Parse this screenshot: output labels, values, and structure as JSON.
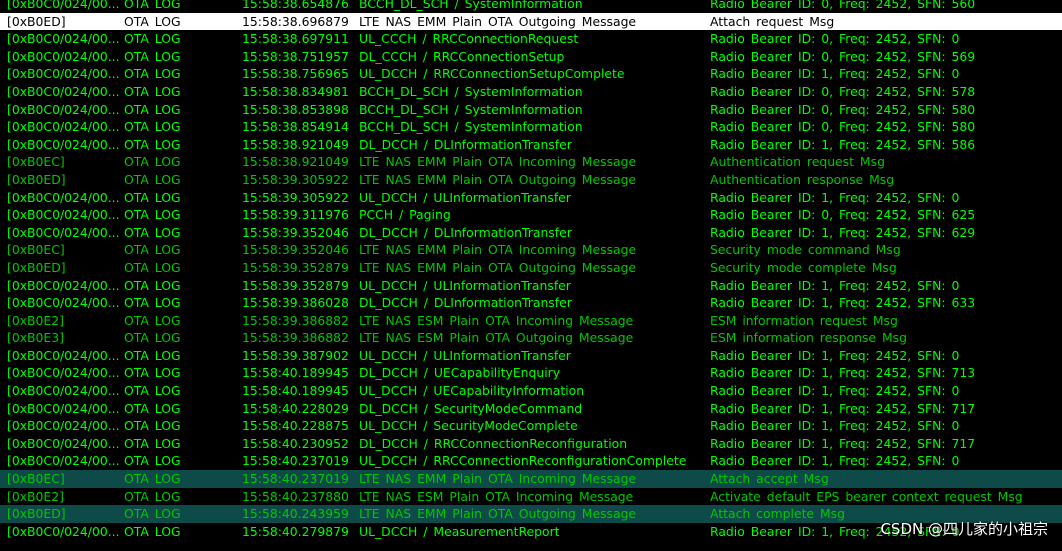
{
  "log": {
    "rows": [
      {
        "id": "[0xB0C0/024/00...",
        "type": "OTA LOG",
        "time": "15:58:38.654876",
        "name": "BCCH_DL_SCH / SystemInformation",
        "info": "Radio Bearer ID: 0, Freq: 2452, SFN: 560",
        "style": "ota"
      },
      {
        "id": "[0xB0ED]",
        "type": "OTA LOG",
        "time": "15:58:38.696879",
        "name": "LTE NAS EMM Plain OTA Outgoing Message",
        "info": "Attach request Msg",
        "style": "sel"
      },
      {
        "id": "[0xB0C0/024/00...",
        "type": "OTA LOG",
        "time": "15:58:38.697911",
        "name": "UL_CCCH / RRCConnectionRequest",
        "info": "Radio Bearer ID: 0, Freq: 2452, SFN: 0",
        "style": "ota"
      },
      {
        "id": "[0xB0C0/024/00...",
        "type": "OTA LOG",
        "time": "15:58:38.751957",
        "name": "DL_CCCH / RRCConnectionSetup",
        "info": "Radio Bearer ID: 0, Freq: 2452, SFN: 569",
        "style": "ota"
      },
      {
        "id": "[0xB0C0/024/00...",
        "type": "OTA LOG",
        "time": "15:58:38.756965",
        "name": "UL_DCCH / RRCConnectionSetupComplete",
        "info": "Radio Bearer ID: 1, Freq: 2452, SFN: 0",
        "style": "ota"
      },
      {
        "id": "[0xB0C0/024/00...",
        "type": "OTA LOG",
        "time": "15:58:38.834981",
        "name": "BCCH_DL_SCH / SystemInformation",
        "info": "Radio Bearer ID: 0, Freq: 2452, SFN: 578",
        "style": "ota"
      },
      {
        "id": "[0xB0C0/024/00...",
        "type": "OTA LOG",
        "time": "15:58:38.853898",
        "name": "BCCH_DL_SCH / SystemInformation",
        "info": "Radio Bearer ID: 0, Freq: 2452, SFN: 580",
        "style": "ota"
      },
      {
        "id": "[0xB0C0/024/00...",
        "type": "OTA LOG",
        "time": "15:58:38.854914",
        "name": "BCCH_DL_SCH / SystemInformation",
        "info": "Radio Bearer ID: 0, Freq: 2452, SFN: 580",
        "style": "ota"
      },
      {
        "id": "[0xB0C0/024/00...",
        "type": "OTA LOG",
        "time": "15:58:38.921049",
        "name": "DL_DCCH / DLInformationTransfer",
        "info": "Radio Bearer ID: 1, Freq: 2452, SFN: 586",
        "style": "ota"
      },
      {
        "id": "[0xB0EC]",
        "type": "OTA LOG",
        "time": "15:58:38.921049",
        "name": "LTE NAS EMM Plain OTA Incoming Message",
        "info": "Authentication request Msg",
        "style": "nas"
      },
      {
        "id": "[0xB0ED]",
        "type": "OTA LOG",
        "time": "15:58:39.305922",
        "name": "LTE NAS EMM Plain OTA Outgoing Message",
        "info": "Authentication response Msg",
        "style": "nas"
      },
      {
        "id": "[0xB0C0/024/00...",
        "type": "OTA LOG",
        "time": "15:58:39.305922",
        "name": "UL_DCCH / ULInformationTransfer",
        "info": "Radio Bearer ID: 1, Freq: 2452, SFN: 0",
        "style": "ota"
      },
      {
        "id": "[0xB0C0/024/00...",
        "type": "OTA LOG",
        "time": "15:58:39.311976",
        "name": "PCCH / Paging",
        "info": "Radio Bearer ID: 0, Freq: 2452, SFN: 625",
        "style": "ota"
      },
      {
        "id": "[0xB0C0/024/00...",
        "type": "OTA LOG",
        "time": "15:58:39.352046",
        "name": "DL_DCCH / DLInformationTransfer",
        "info": "Radio Bearer ID: 1, Freq: 2452, SFN: 629",
        "style": "ota"
      },
      {
        "id": "[0xB0EC]",
        "type": "OTA LOG",
        "time": "15:58:39.352046",
        "name": "LTE NAS EMM Plain OTA Incoming Message",
        "info": "Security mode command Msg",
        "style": "nas"
      },
      {
        "id": "[0xB0ED]",
        "type": "OTA LOG",
        "time": "15:58:39.352879",
        "name": "LTE NAS EMM Plain OTA Outgoing Message",
        "info": "Security mode complete Msg",
        "style": "nas"
      },
      {
        "id": "[0xB0C0/024/00...",
        "type": "OTA LOG",
        "time": "15:58:39.352879",
        "name": "UL_DCCH / ULInformationTransfer",
        "info": "Radio Bearer ID: 1, Freq: 2452, SFN: 0",
        "style": "ota"
      },
      {
        "id": "[0xB0C0/024/00...",
        "type": "OTA LOG",
        "time": "15:58:39.386028",
        "name": "DL_DCCH / DLInformationTransfer",
        "info": "Radio Bearer ID: 1, Freq: 2452, SFN: 633",
        "style": "ota"
      },
      {
        "id": "[0xB0E2]",
        "type": "OTA LOG",
        "time": "15:58:39.386882",
        "name": "LTE NAS ESM Plain OTA Incoming Message",
        "info": "ESM information request Msg",
        "style": "nas"
      },
      {
        "id": "[0xB0E3]",
        "type": "OTA LOG",
        "time": "15:58:39.386882",
        "name": "LTE NAS ESM Plain OTA Outgoing Message",
        "info": "ESM information response Msg",
        "style": "nas"
      },
      {
        "id": "[0xB0C0/024/00...",
        "type": "OTA LOG",
        "time": "15:58:39.387902",
        "name": "UL_DCCH / ULInformationTransfer",
        "info": "Radio Bearer ID: 1, Freq: 2452, SFN: 0",
        "style": "ota"
      },
      {
        "id": "[0xB0C0/024/00...",
        "type": "OTA LOG",
        "time": "15:58:40.189945",
        "name": "DL_DCCH / UECapabilityEnquiry",
        "info": "Radio Bearer ID: 1, Freq: 2452, SFN: 713",
        "style": "ota"
      },
      {
        "id": "[0xB0C0/024/00...",
        "type": "OTA LOG",
        "time": "15:58:40.189945",
        "name": "UL_DCCH / UECapabilityInformation",
        "info": "Radio Bearer ID: 1, Freq: 2452, SFN: 0",
        "style": "ota"
      },
      {
        "id": "[0xB0C0/024/00...",
        "type": "OTA LOG",
        "time": "15:58:40.228029",
        "name": "DL_DCCH / SecurityModeCommand",
        "info": "Radio Bearer ID: 1, Freq: 2452, SFN: 717",
        "style": "ota"
      },
      {
        "id": "[0xB0C0/024/00...",
        "type": "OTA LOG",
        "time": "15:58:40.228875",
        "name": "UL_DCCH / SecurityModeComplete",
        "info": "Radio Bearer ID: 1, Freq: 2452, SFN: 0",
        "style": "ota"
      },
      {
        "id": "[0xB0C0/024/00...",
        "type": "OTA LOG",
        "time": "15:58:40.230952",
        "name": "DL_DCCH / RRCConnectionReconfiguration",
        "info": "Radio Bearer ID: 1, Freq: 2452, SFN: 717",
        "style": "ota"
      },
      {
        "id": "[0xB0C0/024/00...",
        "type": "OTA LOG",
        "time": "15:58:40.237019",
        "name": "UL_DCCH / RRCConnectionReconfigurationComplete",
        "info": "Radio Bearer ID: 1, Freq: 2452, SFN: 0",
        "style": "ota"
      },
      {
        "id": "[0xB0EC]",
        "type": "OTA LOG",
        "time": "15:58:40.237019",
        "name": "LTE NAS EMM Plain OTA Incoming Message",
        "info": "Attach accept Msg",
        "style": "hl"
      },
      {
        "id": "[0xB0E2]",
        "type": "OTA LOG",
        "time": "15:58:40.237880",
        "name": "LTE NAS ESM Plain OTA Incoming Message",
        "info": "Activate default EPS bearer context request Msg",
        "style": "nas"
      },
      {
        "id": "[0xB0ED]",
        "type": "OTA LOG",
        "time": "15:58:40.243959",
        "name": "LTE NAS EMM Plain OTA Outgoing Message",
        "info": "Attach complete Msg",
        "style": "hl"
      },
      {
        "id": "[0xB0C0/024/00...",
        "type": "OTA LOG",
        "time": "15:58:40.279879",
        "name": "UL_DCCH / MeasurementReport",
        "info": "Radio Bearer ID: 1, Freq: 2452, SFN: 0",
        "style": "ota"
      }
    ]
  },
  "watermark": "CSDN @四儿家的小祖宗",
  "colors": {
    "background": "#000000",
    "rrc_text": "#00ff00",
    "nas_text": "#00c800",
    "selected_bg": "#ffffff",
    "highlight_bg": "#0d4a48"
  }
}
